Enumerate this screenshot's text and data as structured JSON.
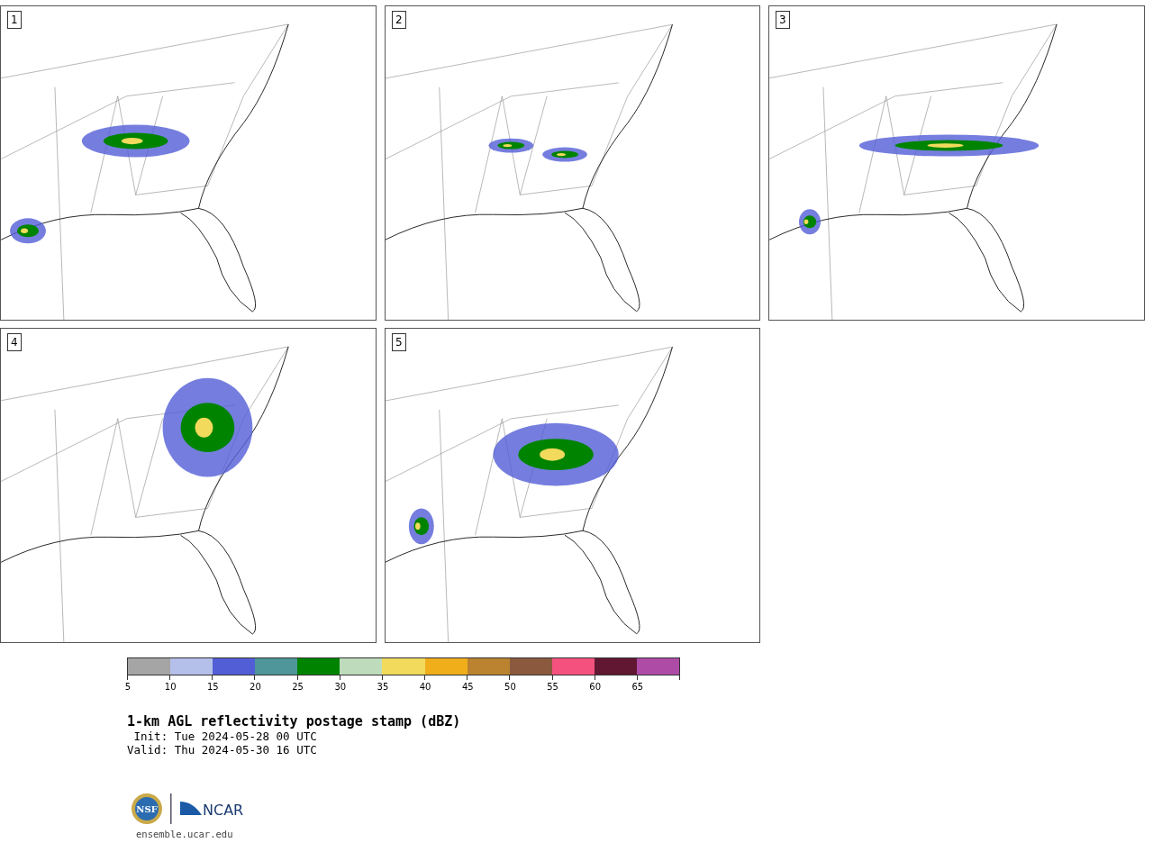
{
  "panels": [
    {
      "label": "1"
    },
    {
      "label": "2"
    },
    {
      "label": "3"
    },
    {
      "label": "4"
    },
    {
      "label": "5"
    }
  ],
  "colorbar": {
    "segments": [
      {
        "color": "#a5a5a5"
      },
      {
        "color": "#b4bfea"
      },
      {
        "color": "#525ed6"
      },
      {
        "color": "#4e969a"
      },
      {
        "color": "#008400"
      },
      {
        "color": "#bedcbc"
      },
      {
        "color": "#f1da5c"
      },
      {
        "color": "#f0ae1a"
      },
      {
        "color": "#bb8330"
      },
      {
        "color": "#8b5a3e"
      },
      {
        "color": "#f5517e"
      },
      {
        "color": "#611732"
      },
      {
        "color": "#ae4ba7"
      }
    ],
    "ticks": [
      "5",
      "10",
      "15",
      "20",
      "25",
      "30",
      "35",
      "40",
      "45",
      "50",
      "55",
      "60",
      "65"
    ]
  },
  "title": "1-km AGL reflectivity postage stamp (dBZ)",
  "init": " Init: Tue 2024-05-28 00 UTC",
  "valid": "Valid: Thu 2024-05-30 16 UTC",
  "logo": {
    "nsf": "NSF",
    "ncar": "NCAR"
  },
  "url": "ensemble.ucar.edu"
}
